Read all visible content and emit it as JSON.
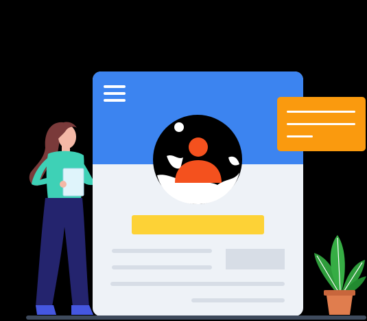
{
  "illustration": {
    "menu_icon": "hamburger-menu-icon",
    "avatar_icon": "user-avatar-icon",
    "note_icon": "text-lines-icon",
    "plant_icon": "potted-plant-icon",
    "person_icon": "woman-holding-tablet-icon"
  },
  "colors": {
    "background": "#000000",
    "card_header": "#3c84f0",
    "card_body": "#eef2f7",
    "avatar_figure": "#f4511e",
    "button": "#fdd236",
    "note": "#fa9a0e",
    "placeholder_lines": "#d7dde6",
    "plant_leaves": "#2e9c3b",
    "pot": "#e07d4e"
  }
}
